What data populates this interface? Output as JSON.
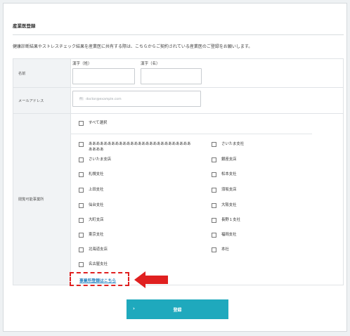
{
  "form": {
    "title": "産業医登録",
    "description": "健康診断結果やストレスチェック結果を産業医に共有する際は、こちらからご契約されている産業医のご登録をお願いします。",
    "name_label": "名前",
    "last_name_label": "漢字（姓）",
    "first_name_label": "漢字（名）",
    "last_name_value": "",
    "first_name_value": "",
    "email_label": "メールアドレス",
    "email_placeholder": "例：doctor@example.com",
    "email_value": "",
    "offices_label": "閲覧可能事業所",
    "select_all": "すべて選択",
    "offices_left": [
      "あああああああああああああああああああああああああああああああ",
      "さいたま支店",
      "札幌支社",
      "上田支社",
      "仙台支社",
      "大町支店",
      "東京支社",
      "北海道支店",
      "名古屋支社"
    ],
    "offices_right": [
      "さいたま支社",
      "銀座支店",
      "松本支社",
      "須坂支店",
      "大阪支社",
      "長野１支社",
      "福岡支社",
      "本社"
    ],
    "office_register_link": "事業所登録はこちら",
    "submit_label": "登録",
    "submit_icon": "chevron-right-icon",
    "accent_color": "#1fa9bd",
    "highlight_color": "#e02020"
  }
}
